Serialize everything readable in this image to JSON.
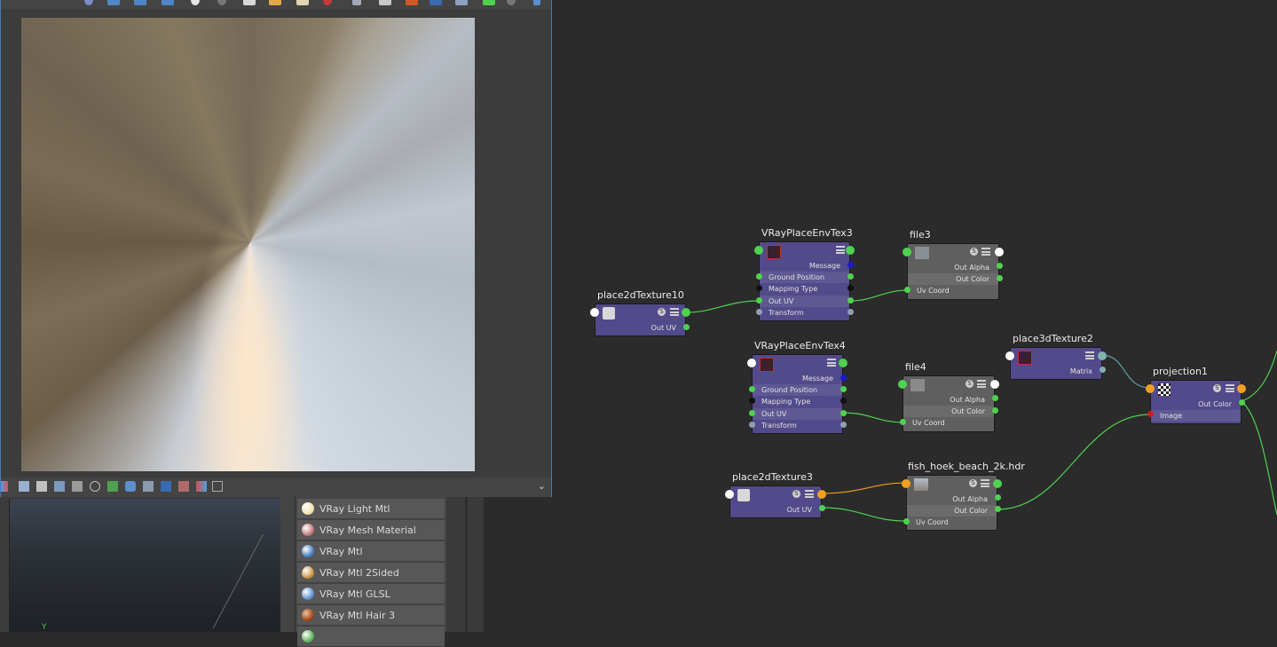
{
  "materials": [
    {
      "label": "VRay Light Mtl",
      "color": "#f2e6b0"
    },
    {
      "label": "VRay Mesh Material",
      "color": "#d08a8a"
    },
    {
      "label": "VRay Mtl",
      "color": "#5a8fd0"
    },
    {
      "label": "VRay Mtl 2Sided",
      "color": "#d9a25a"
    },
    {
      "label": "VRay Mtl GLSL",
      "color": "#6fa0d8"
    },
    {
      "label": "VRay Mtl Hair 3",
      "color": "#b0542a"
    }
  ],
  "nodes": {
    "vrayplaceenvtex3": {
      "title": "VRayPlaceEnvTex3",
      "attrs": [
        "Message",
        "Ground Position",
        "Mapping Type",
        "Out UV",
        "Transform"
      ]
    },
    "file3": {
      "title": "file3",
      "attrs": [
        "Out Alpha",
        "Out Color",
        "Uv Coord"
      ]
    },
    "place2dtexture10": {
      "title": "place2dTexture10",
      "attrs": [
        "Out UV"
      ]
    },
    "vrayplaceenvtex4": {
      "title": "VRayPlaceEnvTex4",
      "attrs": [
        "Message",
        "Ground Position",
        "Mapping Type",
        "Out UV",
        "Transform"
      ]
    },
    "file4": {
      "title": "file4",
      "attrs": [
        "Out Alpha",
        "Out Color",
        "Uv Coord"
      ]
    },
    "place3dtexture2": {
      "title": "place3dTexture2",
      "attrs": [
        "Matrix"
      ]
    },
    "projection1": {
      "title": "projection1",
      "attrs": [
        "Out Color",
        "Image"
      ]
    },
    "place2dtexture3": {
      "title": "place2dTexture3",
      "attrs": [
        "Out UV"
      ]
    },
    "fishhoek": {
      "title": "fish_hoek_beach_2k.hdr",
      "attrs": [
        "Out Alpha",
        "Out Color",
        "Uv Coord"
      ]
    }
  },
  "viewport": {
    "axis_label": "Y"
  },
  "badge": "S",
  "colors": {
    "node_purple": "#524a8a",
    "node_grey": "#5f5f5f",
    "wire_green": "#4fd24f",
    "wire_orange": "#f0a020",
    "window_border": "#4a7ab5"
  }
}
